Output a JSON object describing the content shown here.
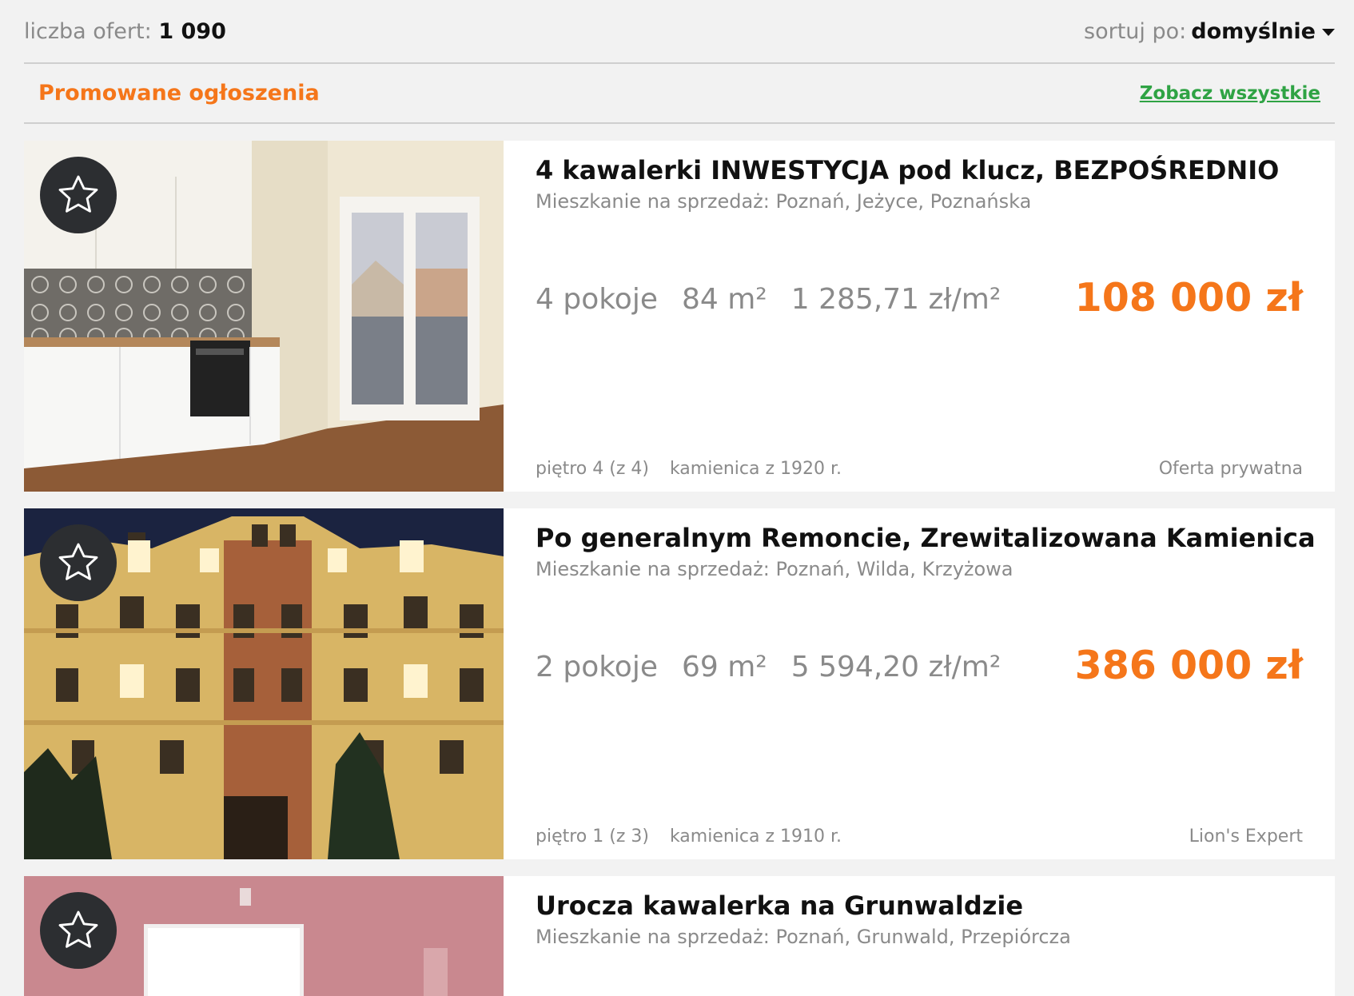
{
  "header": {
    "count_label": "liczba ofert:",
    "count_value": "1 090",
    "sort_label": "sortuj po:",
    "sort_value": "domyślnie"
  },
  "promo": {
    "title": "Promowane ogłoszenia",
    "see_all": "Zobacz wszystkie"
  },
  "listings": [
    {
      "title": "4 kawalerki INWESTYCJA pod klucz, BEZPOŚREDNIO",
      "subtitle": "Mieszkanie na sprzedaż: Poznań, Jeżyce, Poznańska",
      "rooms": "4 pokoje",
      "area": "84 m²",
      "price_per_m2": "1 285,71 zł/m²",
      "price": "108 000 zł",
      "floor": "piętro 4 (z 4)",
      "building": "kamienica z 1920 r.",
      "seller": "Oferta prywatna"
    },
    {
      "title": "Po generalnym Remoncie, Zrewitalizowana Kamienica",
      "subtitle": "Mieszkanie na sprzedaż: Poznań, Wilda, Krzyżowa",
      "rooms": "2 pokoje",
      "area": "69 m²",
      "price_per_m2": "5 594,20 zł/m²",
      "price": "386 000 zł",
      "floor": "piętro 1 (z 3)",
      "building": "kamienica z 1910 r.",
      "seller": "Lion's Expert"
    },
    {
      "title": "Urocza kawalerka na Grunwaldzie",
      "subtitle": "Mieszkanie na sprzedaż: Poznań, Grunwald, Przepiórcza"
    }
  ],
  "colors": {
    "accent": "#f5761a",
    "link": "#2fa344",
    "muted": "#8a8a8a"
  },
  "icons": {
    "favorite": "star-outline-icon",
    "sort": "caret-down-icon"
  }
}
